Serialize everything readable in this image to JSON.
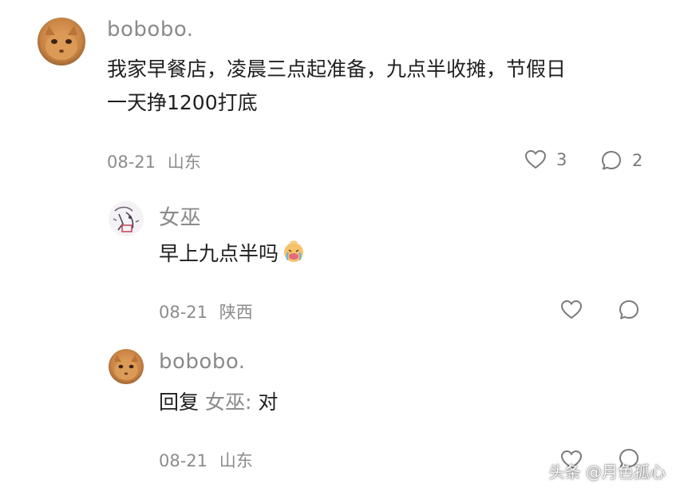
{
  "comments": [
    {
      "username": "bobobo.",
      "text_line1": "我家早餐店，凌晨三点起准备，九点半收摊，节假日",
      "text_line2": "一天挣1200打底",
      "date": "08-21",
      "location": "山东",
      "like_count": "3",
      "reply_count": "2",
      "avatar": "cat-avatar"
    }
  ],
  "replies": [
    {
      "username": "女巫",
      "text": "早上九点半吗",
      "emoji": "crying-face-emoji",
      "date": "08-21",
      "location": "陕西",
      "avatar": "sketch-avatar"
    },
    {
      "username": "bobobo.",
      "reply_prefix": "回复",
      "reply_target": "女巫:",
      "text": "对",
      "date": "08-21",
      "location": "山东",
      "avatar": "cat-avatar"
    }
  ],
  "watermark": "头条 @月色孤心",
  "colors": {
    "text": "#1f1f1f",
    "muted": "#8a8a8a",
    "icon": "#7a7a7a",
    "background": "#ffffff"
  }
}
